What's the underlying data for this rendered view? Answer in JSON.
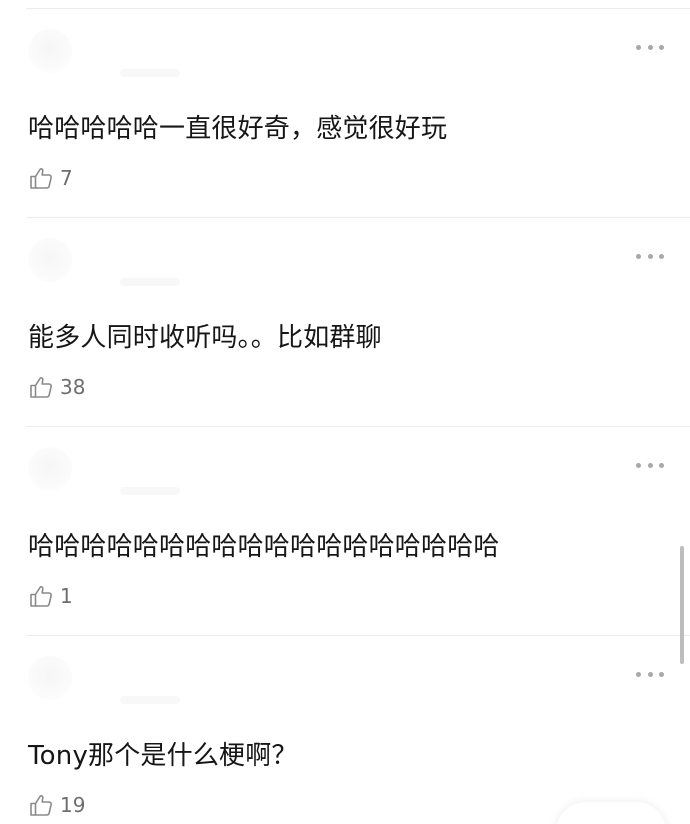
{
  "comments": [
    {
      "text": "哈哈哈哈哈一直很好奇，感觉很好玩",
      "likes": "7"
    },
    {
      "text": "能多人同时收听吗。。比如群聊",
      "likes": "38"
    },
    {
      "text": "哈哈哈哈哈哈哈哈哈哈哈哈哈哈哈哈哈哈",
      "likes": "1"
    },
    {
      "text": "Tony那个是什么梗啊？",
      "likes": "19"
    }
  ],
  "icons": {
    "like": "thumbs-up-icon",
    "more": "more-options-icon"
  },
  "colors": {
    "background": "#ffffff",
    "text": "#161616",
    "muted": "#6e6e6e",
    "divider": "#ececec",
    "icon": "#a8a8a8"
  }
}
